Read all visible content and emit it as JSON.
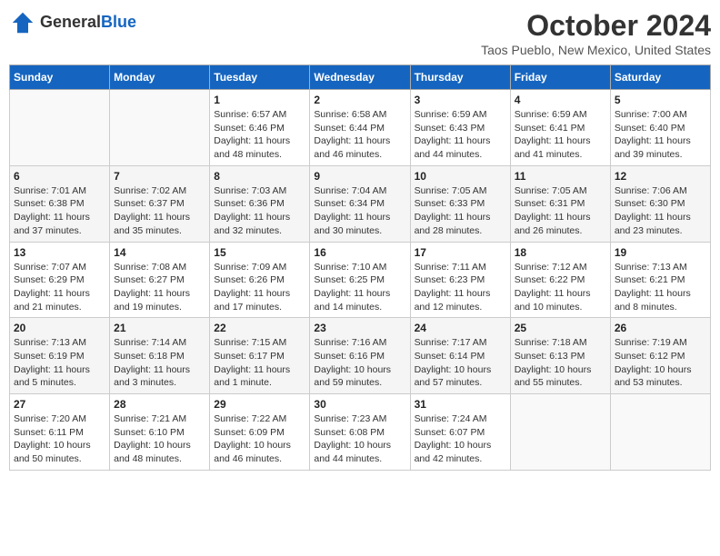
{
  "header": {
    "logo_general": "General",
    "logo_blue": "Blue",
    "month": "October 2024",
    "location": "Taos Pueblo, New Mexico, United States"
  },
  "days_of_week": [
    "Sunday",
    "Monday",
    "Tuesday",
    "Wednesday",
    "Thursday",
    "Friday",
    "Saturday"
  ],
  "weeks": [
    [
      {
        "day": "",
        "info": ""
      },
      {
        "day": "",
        "info": ""
      },
      {
        "day": "1",
        "info": "Sunrise: 6:57 AM\nSunset: 6:46 PM\nDaylight: 11 hours and 48 minutes."
      },
      {
        "day": "2",
        "info": "Sunrise: 6:58 AM\nSunset: 6:44 PM\nDaylight: 11 hours and 46 minutes."
      },
      {
        "day": "3",
        "info": "Sunrise: 6:59 AM\nSunset: 6:43 PM\nDaylight: 11 hours and 44 minutes."
      },
      {
        "day": "4",
        "info": "Sunrise: 6:59 AM\nSunset: 6:41 PM\nDaylight: 11 hours and 41 minutes."
      },
      {
        "day": "5",
        "info": "Sunrise: 7:00 AM\nSunset: 6:40 PM\nDaylight: 11 hours and 39 minutes."
      }
    ],
    [
      {
        "day": "6",
        "info": "Sunrise: 7:01 AM\nSunset: 6:38 PM\nDaylight: 11 hours and 37 minutes."
      },
      {
        "day": "7",
        "info": "Sunrise: 7:02 AM\nSunset: 6:37 PM\nDaylight: 11 hours and 35 minutes."
      },
      {
        "day": "8",
        "info": "Sunrise: 7:03 AM\nSunset: 6:36 PM\nDaylight: 11 hours and 32 minutes."
      },
      {
        "day": "9",
        "info": "Sunrise: 7:04 AM\nSunset: 6:34 PM\nDaylight: 11 hours and 30 minutes."
      },
      {
        "day": "10",
        "info": "Sunrise: 7:05 AM\nSunset: 6:33 PM\nDaylight: 11 hours and 28 minutes."
      },
      {
        "day": "11",
        "info": "Sunrise: 7:05 AM\nSunset: 6:31 PM\nDaylight: 11 hours and 26 minutes."
      },
      {
        "day": "12",
        "info": "Sunrise: 7:06 AM\nSunset: 6:30 PM\nDaylight: 11 hours and 23 minutes."
      }
    ],
    [
      {
        "day": "13",
        "info": "Sunrise: 7:07 AM\nSunset: 6:29 PM\nDaylight: 11 hours and 21 minutes."
      },
      {
        "day": "14",
        "info": "Sunrise: 7:08 AM\nSunset: 6:27 PM\nDaylight: 11 hours and 19 minutes."
      },
      {
        "day": "15",
        "info": "Sunrise: 7:09 AM\nSunset: 6:26 PM\nDaylight: 11 hours and 17 minutes."
      },
      {
        "day": "16",
        "info": "Sunrise: 7:10 AM\nSunset: 6:25 PM\nDaylight: 11 hours and 14 minutes."
      },
      {
        "day": "17",
        "info": "Sunrise: 7:11 AM\nSunset: 6:23 PM\nDaylight: 11 hours and 12 minutes."
      },
      {
        "day": "18",
        "info": "Sunrise: 7:12 AM\nSunset: 6:22 PM\nDaylight: 11 hours and 10 minutes."
      },
      {
        "day": "19",
        "info": "Sunrise: 7:13 AM\nSunset: 6:21 PM\nDaylight: 11 hours and 8 minutes."
      }
    ],
    [
      {
        "day": "20",
        "info": "Sunrise: 7:13 AM\nSunset: 6:19 PM\nDaylight: 11 hours and 5 minutes."
      },
      {
        "day": "21",
        "info": "Sunrise: 7:14 AM\nSunset: 6:18 PM\nDaylight: 11 hours and 3 minutes."
      },
      {
        "day": "22",
        "info": "Sunrise: 7:15 AM\nSunset: 6:17 PM\nDaylight: 11 hours and 1 minute."
      },
      {
        "day": "23",
        "info": "Sunrise: 7:16 AM\nSunset: 6:16 PM\nDaylight: 10 hours and 59 minutes."
      },
      {
        "day": "24",
        "info": "Sunrise: 7:17 AM\nSunset: 6:14 PM\nDaylight: 10 hours and 57 minutes."
      },
      {
        "day": "25",
        "info": "Sunrise: 7:18 AM\nSunset: 6:13 PM\nDaylight: 10 hours and 55 minutes."
      },
      {
        "day": "26",
        "info": "Sunrise: 7:19 AM\nSunset: 6:12 PM\nDaylight: 10 hours and 53 minutes."
      }
    ],
    [
      {
        "day": "27",
        "info": "Sunrise: 7:20 AM\nSunset: 6:11 PM\nDaylight: 10 hours and 50 minutes."
      },
      {
        "day": "28",
        "info": "Sunrise: 7:21 AM\nSunset: 6:10 PM\nDaylight: 10 hours and 48 minutes."
      },
      {
        "day": "29",
        "info": "Sunrise: 7:22 AM\nSunset: 6:09 PM\nDaylight: 10 hours and 46 minutes."
      },
      {
        "day": "30",
        "info": "Sunrise: 7:23 AM\nSunset: 6:08 PM\nDaylight: 10 hours and 44 minutes."
      },
      {
        "day": "31",
        "info": "Sunrise: 7:24 AM\nSunset: 6:07 PM\nDaylight: 10 hours and 42 minutes."
      },
      {
        "day": "",
        "info": ""
      },
      {
        "day": "",
        "info": ""
      }
    ]
  ]
}
